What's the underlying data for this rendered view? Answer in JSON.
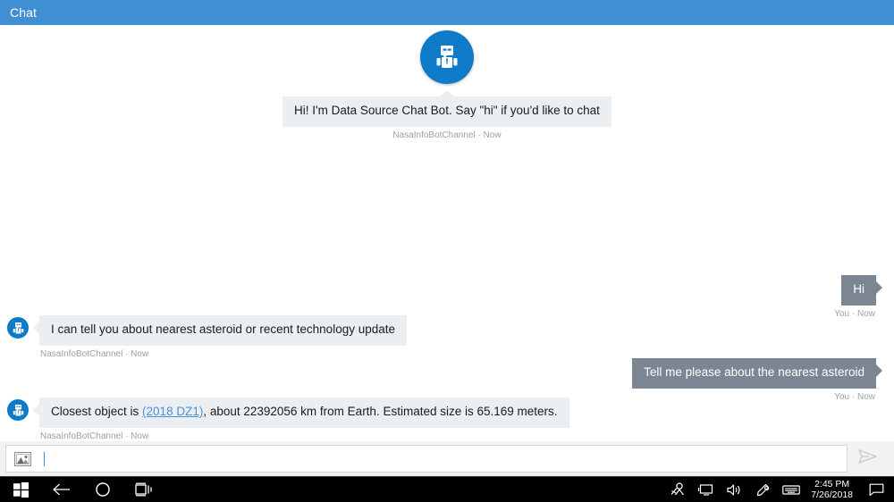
{
  "window": {
    "title": "Chat",
    "titlebar_color": "#3f8fd2"
  },
  "colors": {
    "accent": "#3f8fd2",
    "bot_avatar": "#0f7ac7",
    "bot_bubble": "#eceff1",
    "user_bubble": "#7b8692",
    "link": "#4a90d9",
    "meta_text": "#9aa0a6"
  },
  "intro": {
    "avatar_icon": "bot-icon",
    "bubble_text": "Hi! I'm Data Source Chat Bot. Say \"hi\" if you'd like to chat",
    "meta": "NasaInfoBotChannel · Now"
  },
  "messages": [
    {
      "id": "m1",
      "from": "user",
      "text": "Hi",
      "meta": "You · Now"
    },
    {
      "id": "m2",
      "from": "bot",
      "avatar_icon": "bot-icon",
      "text": "I can tell you about nearest asteroid or recent technology update",
      "meta": "NasaInfoBotChannel · Now"
    },
    {
      "id": "m3",
      "from": "user",
      "text": "Tell me please about the nearest asteroid",
      "meta": "You · Now"
    },
    {
      "id": "m4",
      "from": "bot",
      "avatar_icon": "bot-icon",
      "text_before_link": "Closest object is ",
      "link_text": "(2018 DZ1)",
      "text_after_link": ", about 22392056 km from Earth. Estimated size is 65.169 meters.",
      "meta": "NasaInfoBotChannel · Now"
    }
  ],
  "composer": {
    "attach_icon": "image-icon",
    "input_value": "",
    "input_placeholder": "",
    "send_icon": "send-icon"
  },
  "taskbar": {
    "start_icon": "windows-start-icon",
    "back_icon": "back-arrow-icon",
    "cortana_icon": "cortana-circle-icon",
    "taskview_icon": "task-view-icon",
    "tray": [
      {
        "icon": "people-icon"
      },
      {
        "icon": "monitor-icon"
      },
      {
        "icon": "volume-icon"
      },
      {
        "icon": "pen-icon"
      },
      {
        "icon": "keyboard-icon"
      }
    ],
    "clock_time": "2:45 PM",
    "clock_date": "7/26/2018",
    "action_center_icon": "notification-icon"
  }
}
